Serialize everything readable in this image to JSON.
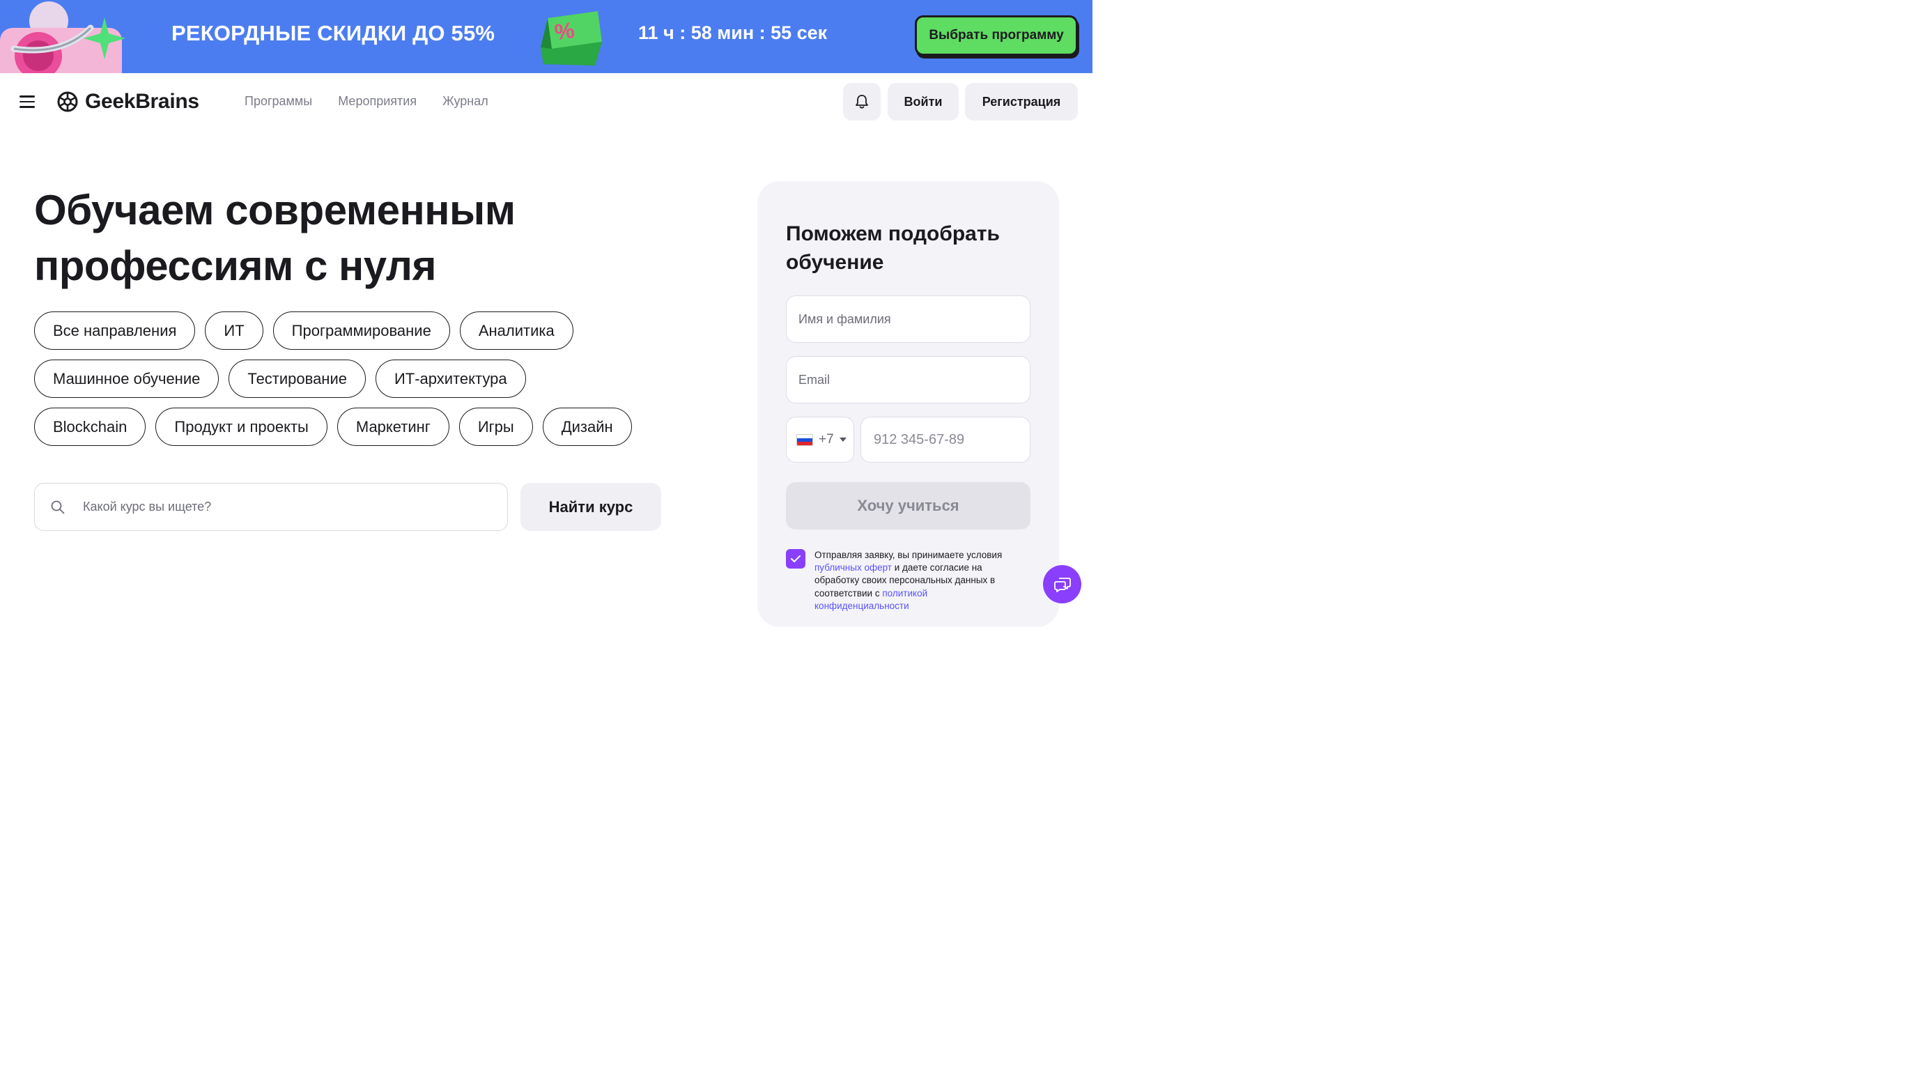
{
  "promo": {
    "headline": "РЕКОРДНЫЕ СКИДКИ ДО 55%",
    "badge_symbol": "%",
    "timer": "11 ч : 58 мин : 55 сек",
    "cta_label": "Выбрать программу",
    "background_color": "#4c7df0",
    "cta_color": "#5fdc62"
  },
  "header": {
    "menu_icon": "hamburger-icon",
    "logo_text": "GeekBrains",
    "nav": [
      {
        "label": "Программы"
      },
      {
        "label": "Мероприятия"
      },
      {
        "label": "Журнал"
      }
    ],
    "bell_icon": "bell-icon",
    "login_label": "Войти",
    "register_label": "Регистрация"
  },
  "hero": {
    "title_line1": "Обучаем современным",
    "title_line2": "профессиям с нуля",
    "chips": [
      [
        "Все направления",
        "ИТ",
        "Программирование",
        "Аналитика"
      ],
      [
        "Машинное обучение",
        "Тестирование",
        "ИТ-архитектура"
      ],
      [
        "Blockchain",
        "Продукт и проекты",
        "Маркетинг",
        "Игры",
        "Дизайн"
      ]
    ],
    "search_placeholder": "Какой курс вы ищете?",
    "search_icon": "search-icon",
    "find_label": "Найти курс"
  },
  "form": {
    "title": "Поможем подобрать обучение",
    "name_placeholder": "Имя и фамилия",
    "email_placeholder": "Email",
    "country_code": "+7",
    "country_flag": "russia-flag-icon",
    "phone_placeholder": "912 345-67-89",
    "submit_label": "Хочу учиться",
    "consent_checked": true,
    "consent_text_1": "Отправляя заявку, вы принимаете условия ",
    "consent_link_1": "публичных оферт",
    "consent_text_2": " и даете согласие на обработку своих персональных данных в соответствии с ",
    "consent_link_2": "политикой конфиденциальности",
    "accent_color": "#8a3ffc"
  },
  "chat": {
    "icon": "chat-icon"
  }
}
